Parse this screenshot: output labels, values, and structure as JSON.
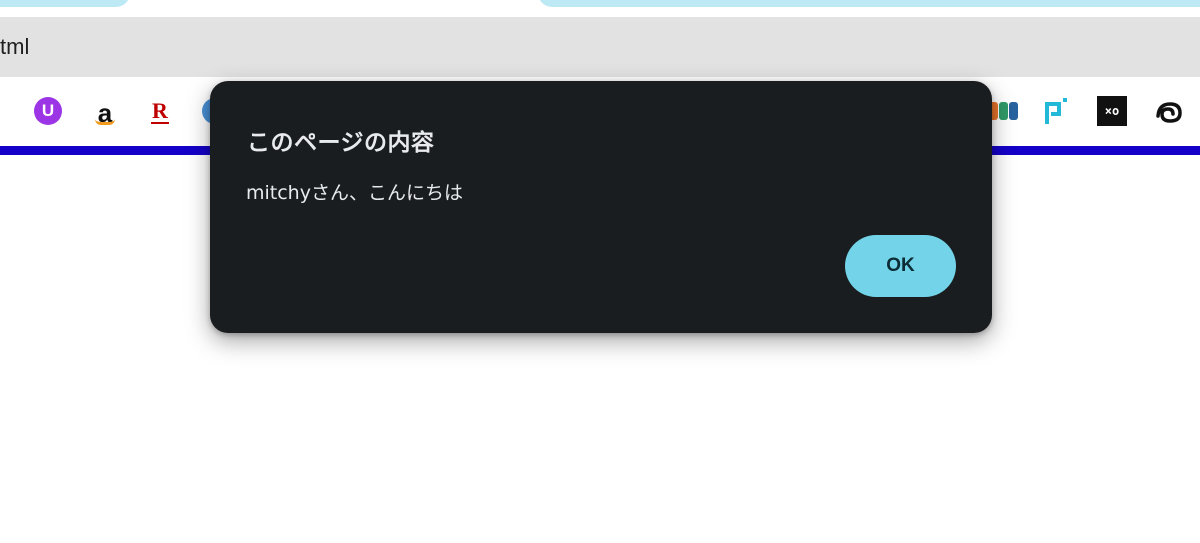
{
  "browser": {
    "url_text": "tml",
    "bookmarks": [
      {
        "name": "u-icon",
        "glyph": "U"
      },
      {
        "name": "amazon-icon",
        "glyph": "a"
      },
      {
        "name": "rakuten-icon",
        "glyph": "R"
      },
      {
        "name": "globe-icon"
      },
      {
        "name": "tb-icon"
      },
      {
        "name": "pixel-p-icon"
      },
      {
        "name": "glasses-icon",
        "glyph": "×o"
      },
      {
        "name": "swirl-icon"
      }
    ]
  },
  "dialog": {
    "title": "このページの内容",
    "message": "mitchyさん、こんにちは",
    "ok_label": "OK"
  },
  "colors": {
    "dialog_bg": "#1a1d20",
    "button_bg": "#73d3e8",
    "page_bar": "#1400c8",
    "tab_bg": "#bde9f5"
  }
}
